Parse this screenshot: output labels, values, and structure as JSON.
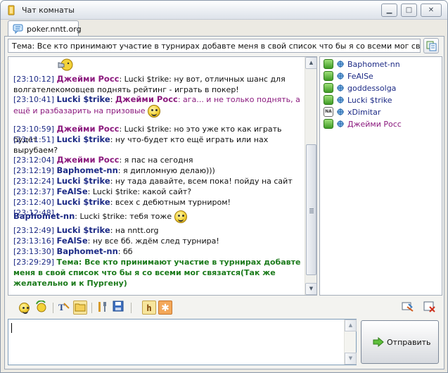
{
  "window": {
    "title": "Чат комнаты"
  },
  "tabs": [
    {
      "label": "poker.nntt.org"
    }
  ],
  "topic_bar": {
    "text": "Тема: Все кто принимают участие в турнирах добавте меня в свой список что бы я со всеми мог связатся(Так же"
  },
  "messages": [
    {
      "time": "[23:10:12]",
      "nick": "Джейми Росс",
      "text": ": Lucki $trike: ну вот, отличных шанс для волгателекомовцев поднять рейтинг - играть в покер!"
    },
    {
      "time": "[23:10:41]",
      "nick": "Lucki $trike",
      "text_before": ": ",
      "mention": "Джейми Росс",
      "text": ": ага... и не только поднять, а ещё и разбазарить на призовые"
    },
    {
      "time": "[23:10:59]",
      "nick": "Джейми Росс",
      "text": ": Lucki $trike: но это уже кто как играть будет"
    },
    {
      "time": "[23:11:51]",
      "nick": "Lucki $trike",
      "text": ": ну что-будет кто ещё играть или нах вырубаем?"
    },
    {
      "time": "[23:12:04]",
      "nick": "Джейми Росс",
      "text": ": я пас на сегодня"
    },
    {
      "time": "[23:12:19]",
      "nick": "Baphomet-nn",
      "text": ": я дипломную делаю)))"
    },
    {
      "time": "[23:12:24]",
      "nick": "Lucki $trike",
      "text": ": ну тада давайте, всем пока! пойду на сайт"
    },
    {
      "time": "[23:12:37]",
      "nick": "FeAlSe",
      "text": ": Lucki $trike: какой сайт?"
    },
    {
      "time": "[23:12:40]",
      "nick": "Lucki $trike",
      "text": ": всех с дебютным турниром!"
    },
    {
      "time": "[23:12:48]",
      "nick": "Baphomet-nn",
      "text": ": Lucki $trike: тебя тоже"
    },
    {
      "time": "[23:12:49]",
      "nick": "Lucki $trike",
      "text": ": на nntt.org"
    },
    {
      "time": "[23:13:16]",
      "nick": "FeAlSe",
      "text": ": ну все бб. ждём след турнира!"
    },
    {
      "time": "[23:13:30]",
      "nick": "Baphomet-nn",
      "text": ": бб"
    },
    {
      "time": "[23:29:29]",
      "topic": "Тема: Все кто принимают участие в турнирах добавте меня в свой список что бы я со всеми мог связатся(Так же желательно и к Пургену)"
    }
  ],
  "users": [
    {
      "name": "Baphomet-nn",
      "role": "op",
      "color": "#1c2a85"
    },
    {
      "name": "FeAlSe",
      "role": "op",
      "color": "#1c2a85"
    },
    {
      "name": "goddessolga",
      "role": "op",
      "color": "#1c2a85"
    },
    {
      "name": "Lucki $trike",
      "role": "op",
      "color": "#1c2a85"
    },
    {
      "name": "xDimitar",
      "role": "NA",
      "color": "#1c2a85"
    },
    {
      "name": "Джейми Росс",
      "role": "op",
      "color": "#8b1a7e"
    }
  ],
  "compose": {
    "value": "",
    "send_label": "Отправить"
  },
  "icons": {
    "toolbar": [
      "smiley-icon",
      "refresh-smiley-icon",
      "text-format-icon",
      "folder-icon",
      "tools-icon",
      "save-icon",
      "highlight-h-icon",
      "flower-icon"
    ],
    "right": [
      "clear-chat-icon",
      "close-room-icon"
    ]
  },
  "colors": {
    "nick_blue": "#1c2a85",
    "nick_purple": "#8b1a7e",
    "topic_green": "#1b7a1b"
  }
}
